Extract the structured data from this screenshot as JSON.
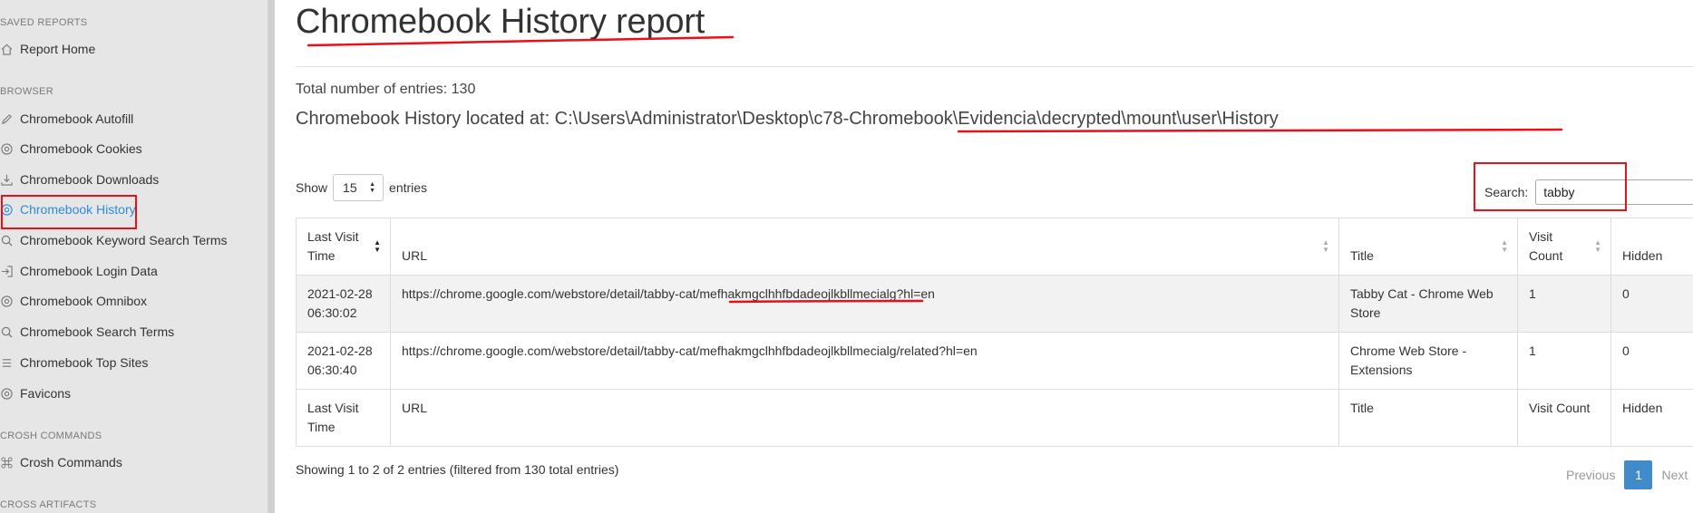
{
  "sidebar": {
    "sections": [
      {
        "title": "SAVED REPORTS",
        "items": [
          {
            "label": "Report Home",
            "icon": "home-icon"
          }
        ]
      },
      {
        "title": "BROWSER",
        "items": [
          {
            "label": "Chromebook Autofill",
            "icon": "pencil-icon"
          },
          {
            "label": "Chromebook Cookies",
            "icon": "chrome-icon"
          },
          {
            "label": "Chromebook Downloads",
            "icon": "download-icon"
          },
          {
            "label": "Chromebook History",
            "icon": "chrome-icon"
          },
          {
            "label": "Chromebook Keyword Search Terms",
            "icon": "search-icon"
          },
          {
            "label": "Chromebook Login Data",
            "icon": "login-icon"
          },
          {
            "label": "Chromebook Omnibox",
            "icon": "chrome-icon"
          },
          {
            "label": "Chromebook Search Terms",
            "icon": "search-icon"
          },
          {
            "label": "Chromebook Top Sites",
            "icon": "list-icon"
          },
          {
            "label": "Favicons",
            "icon": "chrome-icon"
          }
        ]
      },
      {
        "title": "CROSH COMMANDS",
        "items": [
          {
            "label": "Crosh Commands",
            "icon": "command-icon"
          }
        ]
      },
      {
        "title": "CROSS ARTIFACTS",
        "items": []
      }
    ]
  },
  "main": {
    "title": "Chromebook History report",
    "total": "Total number of entries: 130",
    "location": "Chromebook History located at: C:\\Users\\Administrator\\Desktop\\c78-Chromebook\\Evidencia\\decrypted\\mount\\user\\History",
    "show_label": "Show",
    "show_value": "15",
    "entries_label": "entries",
    "search_label": "Search:",
    "search_value": "tabby"
  },
  "table": {
    "headers": [
      "Last Visit Time",
      "URL",
      "Title",
      "Visit Count",
      "Hidden"
    ],
    "rows": [
      [
        "2021-02-28 06:30:02",
        "https://chrome.google.com/webstore/detail/tabby-cat/mefhakmgclhhfbdadeojlkbllmecialg?hl=en",
        "Tabby Cat - Chrome Web Store",
        "1",
        "0"
      ],
      [
        "2021-02-28 06:30:40",
        "https://chrome.google.com/webstore/detail/tabby-cat/mefhakmgclhhfbdadeojlkbllmecialg/related?hl=en",
        "Chrome Web Store - Extensions",
        "1",
        "0"
      ]
    ],
    "footers": [
      "Last Visit Time",
      "URL",
      "Title",
      "Visit Count",
      "Hidden"
    ]
  },
  "info": "Showing 1 to 2 of 2 entries (filtered from 130 total entries)",
  "pager": {
    "previous": "Previous",
    "page": "1",
    "next": "Next"
  },
  "colors": {
    "accent": "#428bca",
    "annotation": "#e8101a",
    "active_link": "#2b8be0"
  }
}
